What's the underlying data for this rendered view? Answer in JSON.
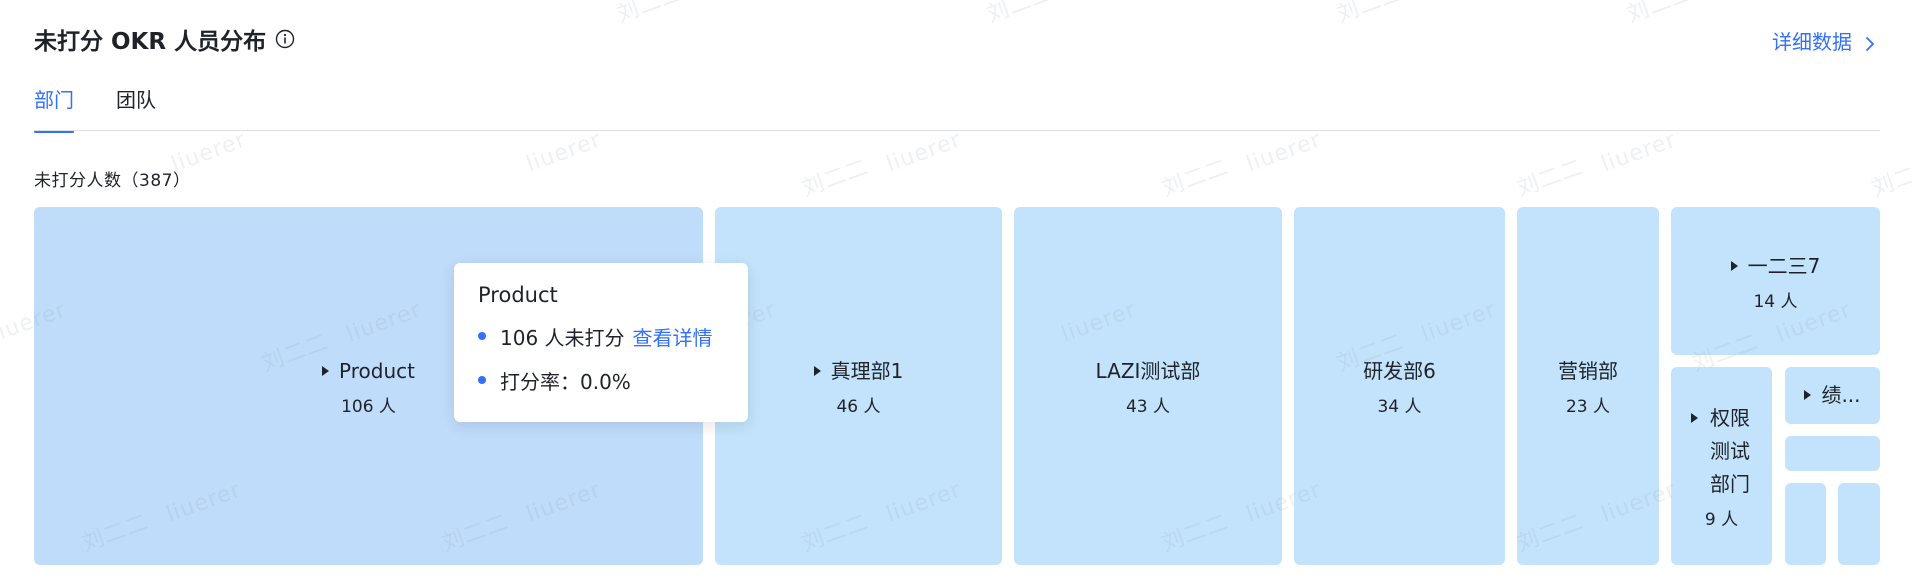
{
  "header": {
    "title": "未打分 OKR 人员分布",
    "details_link": "详细数据"
  },
  "tabs": [
    {
      "label": "部门",
      "active": true
    },
    {
      "label": "团队",
      "active": false
    }
  ],
  "count_label": "未打分人数（387）",
  "watermark": {
    "name": "刘二二",
    "id": "liuerer"
  },
  "colors": {
    "accent": "#3370ff",
    "cell": "#c2e3fb",
    "cell_hover": "#bfdcfb",
    "text": "#1f2329"
  },
  "treemap": {
    "cells": [
      {
        "name": "Product",
        "count": "106 人",
        "expandable": true,
        "hover": true
      },
      {
        "name": "真理部1",
        "count": "46 人",
        "expandable": true
      },
      {
        "name": "LAZI测试部",
        "count": "43 人",
        "expandable": false
      },
      {
        "name": "研发部6",
        "count": "34 人",
        "expandable": false
      },
      {
        "name": "营销部",
        "count": "23 人",
        "expandable": false
      },
      {
        "name": "一二三7",
        "count": "14 人",
        "expandable": true
      },
      {
        "name": "权限测试部门",
        "count": "9 人",
        "expandable": true
      },
      {
        "name": "绩...",
        "count": "",
        "expandable": true
      },
      {
        "name": "",
        "count": ""
      },
      {
        "name": "",
        "count": ""
      },
      {
        "name": "",
        "count": ""
      }
    ]
  },
  "tooltip": {
    "title": "Product",
    "count_text": "106 人未打分",
    "link": "查看详情",
    "rate_text": "打分率：0.0%"
  }
}
